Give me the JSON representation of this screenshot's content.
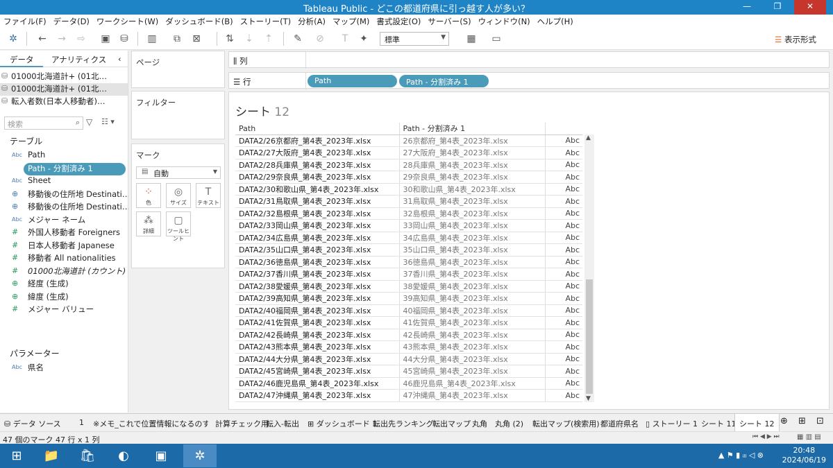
{
  "window": {
    "title": "Tableau Public - どこの都道府県に引っ越す人が多い？",
    "minimize": "—",
    "maximize": "❐",
    "close": "✕"
  },
  "menu": [
    "ファイル(F)",
    "データ(D)",
    "ワークシート(W)",
    "ダッシュボード(B)",
    "ストーリー(T)",
    "分析(A)",
    "マップ(M)",
    "書式設定(O)",
    "サーバー(S)",
    "ウィンドウ(N)",
    "ヘルプ(H)"
  ],
  "toolbar": {
    "standard_label": "標準",
    "show_me_label": "表示形式"
  },
  "leftpane": {
    "tab_data": "データ",
    "tab_analytics": "アナリティクス",
    "collapse": "‹",
    "datasources": [
      "01000北海道計+ (01北…",
      "01000北海道計+ (01北…",
      "転入者数(日本人移動者)…"
    ],
    "search_placeholder": "検索",
    "tables_header": "テーブル",
    "fields": [
      {
        "icon": "Abc",
        "label": "Path"
      },
      {
        "icon": "Abc",
        "label": "Path - 分割済み 1"
      },
      {
        "icon": "Abc",
        "label": "Sheet"
      },
      {
        "icon": "⊕",
        "label": "移動後の住所地 Destinati…"
      },
      {
        "icon": "⊕",
        "label": "移動後の住所地 Destinati…"
      },
      {
        "icon": "Abc",
        "label": "メジャー ネーム"
      },
      {
        "icon": "#",
        "label": "外国人移動者 Foreigners"
      },
      {
        "icon": "#",
        "label": "日本人移動者 Japanese"
      },
      {
        "icon": "#",
        "label": "移動者 All nationalities"
      },
      {
        "icon": "#",
        "label": "01000北海道計 (カウント)"
      },
      {
        "icon": "⊕",
        "label": "経度 (生成)"
      },
      {
        "icon": "⊕",
        "label": "緯度 (生成)"
      },
      {
        "icon": "#",
        "label": "メジャー バリュー"
      }
    ],
    "params_header": "パラメーター",
    "param": {
      "icon": "Abc",
      "label": "県名"
    }
  },
  "shelves": {
    "pages": "ページ",
    "filters": "フィルター",
    "marks": "マーク",
    "mark_type": "自動",
    "mark_buttons": [
      "色",
      "サイズ",
      "テキスト",
      "詳細",
      "ツールヒント"
    ],
    "columns_label": "列",
    "rows_label": "行",
    "row_pills": [
      "Path",
      "Path - 分割済み 1"
    ]
  },
  "view": {
    "sheet_title": "シート",
    "sheet_num": "12",
    "headers": [
      "Path",
      "Path - 分割済み 1"
    ],
    "rows": [
      [
        "DATA2/26京都府_第4表_2023年.xlsx",
        "26京都府_第4表_2023年.xlsx",
        "Abc"
      ],
      [
        "DATA2/27大阪府_第4表_2023年.xlsx",
        "27大阪府_第4表_2023年.xlsx",
        "Abc"
      ],
      [
        "DATA2/28兵庫県_第4表_2023年.xlsx",
        "28兵庫県_第4表_2023年.xlsx",
        "Abc"
      ],
      [
        "DATA2/29奈良県_第4表_2023年.xlsx",
        "29奈良県_第4表_2023年.xlsx",
        "Abc"
      ],
      [
        "DATA2/30和歌山県_第4表_2023年.xlsx",
        "30和歌山県_第4表_2023年.xlsx",
        "Abc"
      ],
      [
        "DATA2/31鳥取県_第4表_2023年.xlsx",
        "31鳥取県_第4表_2023年.xlsx",
        "Abc"
      ],
      [
        "DATA2/32島根県_第4表_2023年.xlsx",
        "32島根県_第4表_2023年.xlsx",
        "Abc"
      ],
      [
        "DATA2/33岡山県_第4表_2023年.xlsx",
        "33岡山県_第4表_2023年.xlsx",
        "Abc"
      ],
      [
        "DATA2/34広島県_第4表_2023年.xlsx",
        "34広島県_第4表_2023年.xlsx",
        "Abc"
      ],
      [
        "DATA2/35山口県_第4表_2023年.xlsx",
        "35山口県_第4表_2023年.xlsx",
        "Abc"
      ],
      [
        "DATA2/36徳島県_第4表_2023年.xlsx",
        "36徳島県_第4表_2023年.xlsx",
        "Abc"
      ],
      [
        "DATA2/37香川県_第4表_2023年.xlsx",
        "37香川県_第4表_2023年.xlsx",
        "Abc"
      ],
      [
        "DATA2/38愛媛県_第4表_2023年.xlsx",
        "38愛媛県_第4表_2023年.xlsx",
        "Abc"
      ],
      [
        "DATA2/39高知県_第4表_2023年.xlsx",
        "39高知県_第4表_2023年.xlsx",
        "Abc"
      ],
      [
        "DATA2/40福岡県_第4表_2023年.xlsx",
        "40福岡県_第4表_2023年.xlsx",
        "Abc"
      ],
      [
        "DATA2/41佐賀県_第4表_2023年.xlsx",
        "41佐賀県_第4表_2023年.xlsx",
        "Abc"
      ],
      [
        "DATA2/42長崎県_第4表_2023年.xlsx",
        "42長崎県_第4表_2023年.xlsx",
        "Abc"
      ],
      [
        "DATA2/43熊本県_第4表_2023年.xlsx",
        "43熊本県_第4表_2023年.xlsx",
        "Abc"
      ],
      [
        "DATA2/44大分県_第4表_2023年.xlsx",
        "44大分県_第4表_2023年.xlsx",
        "Abc"
      ],
      [
        "DATA2/45宮崎県_第4表_2023年.xlsx",
        "45宮崎県_第4表_2023年.xlsx",
        "Abc"
      ],
      [
        "DATA2/46鹿児島県_第4表_2023年.xlsx",
        "46鹿児島県_第4表_2023年.xlsx",
        "Abc"
      ],
      [
        "DATA2/47沖縄県_第4表_2023年.xlsx",
        "47沖縄県_第4表_2023年.xlsx",
        "Abc"
      ]
    ]
  },
  "sheettabs": [
    "データ ソース",
    "1",
    "※メモ_これで位置情報になるのすご…",
    "計算チェック用",
    "転入-転出",
    "ダッシュボード 1",
    "転出先ランキング",
    "転出マップ",
    "丸角",
    "丸角 (2)",
    "転出マップ(検索用)",
    "都道府県名",
    "ストーリー 1",
    "シート 11",
    "シート 12"
  ],
  "status": {
    "marks": "47 個のマーク",
    "dims": "47 行 x 1 列"
  },
  "taskbar": {
    "time": "20:48",
    "date": "2024/06/19"
  },
  "colors": {
    "titlebar": "#1e84c6",
    "pill": "#4a9bb9",
    "taskbar": "#1d6aa8"
  }
}
